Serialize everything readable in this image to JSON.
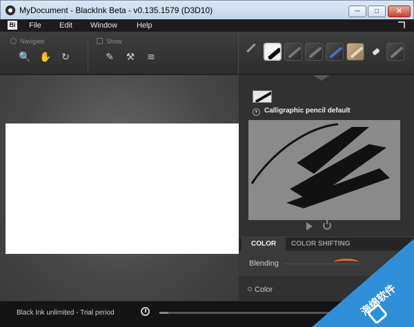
{
  "window": {
    "title": "MyDocument - BlackInk Beta - v0.135.1579 (D3D10)",
    "min_label": "─",
    "max_label": "□",
    "close_label": "✕"
  },
  "menubar": {
    "logo": "Bi",
    "items": [
      "File",
      "Edit",
      "Window",
      "Help"
    ]
  },
  "toolbar": {
    "navigate_label": "Navigate",
    "show_label": "Show",
    "navigate_icons": [
      "zoom-icon",
      "hand-pan-icon",
      "rotate-view-icon"
    ],
    "show_icons": [
      "brush-show-icon",
      "palette-show-icon",
      "layers-icon"
    ],
    "navigate_glyphs": [
      "🔍",
      "✋",
      "↻"
    ],
    "show_glyphs": [
      "✎",
      "⚒",
      "≋"
    ],
    "brushes": [
      "pencil",
      "calligraphic-pencil",
      "brush-2",
      "brush-3",
      "brush-blue",
      "brush-tan",
      "eraser",
      "brush-8"
    ],
    "selected_brush": "calligraphic-pencil"
  },
  "panel": {
    "brush_name": "Calligraphic pencil default",
    "tabs": [
      "COLOR",
      "COLOR SHIFTING"
    ],
    "active_tab": "COLOR",
    "blending_label": "Blending",
    "color_label": "Color",
    "accent_color": "#d8702c"
  },
  "status": {
    "text": "Black Ink unlimited - Trial period",
    "progress": 0.05
  },
  "watermark": {
    "text": "海绵软件"
  }
}
